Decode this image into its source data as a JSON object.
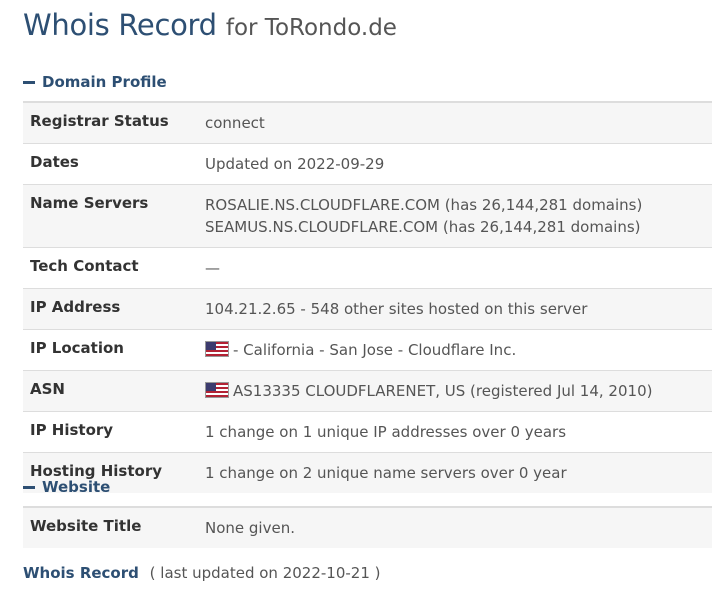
{
  "page": {
    "title_main": "Whois Record",
    "title_sub": "for ToRondo.de"
  },
  "domain_profile": {
    "heading": "Domain Profile",
    "rows": [
      {
        "label": "Registrar Status",
        "values": [
          "connect"
        ]
      },
      {
        "label": "Dates",
        "values": [
          "Updated on 2022-09-29"
        ]
      },
      {
        "label": "Name Servers",
        "values": [
          "ROSALIE.NS.CLOUDFLARE.COM (has 26,144,281 domains)",
          "SEAMUS.NS.CLOUDFLARE.COM (has 26,144,281 domains)"
        ]
      },
      {
        "label": "Tech Contact",
        "values": [
          "—"
        ]
      },
      {
        "label": "IP Address",
        "values": [
          "104.21.2.65 - 548 other sites hosted on this server"
        ]
      },
      {
        "label": "IP Location",
        "values": [
          "- California - San Jose - Cloudflare Inc."
        ],
        "flag": "us-flag-icon"
      },
      {
        "label": "ASN",
        "values": [
          "AS13335 CLOUDFLARENET, US (registered Jul 14, 2010)"
        ],
        "flag": "us-flag-icon"
      },
      {
        "label": "IP History",
        "values": [
          "1 change on 1 unique IP addresses over 0 years"
        ]
      },
      {
        "label": "Hosting History",
        "values": [
          "1 change on 2 unique name servers over 0 year"
        ]
      }
    ]
  },
  "website": {
    "heading": "Website",
    "rows": [
      {
        "label": "Website Title",
        "values": [
          "None given."
        ]
      }
    ]
  },
  "footer": {
    "link": "Whois Record",
    "updated": "( last updated on 2022-10-21 )"
  },
  "colors": {
    "accent": "#2d4f73",
    "row_shade": "#f6f6f6",
    "border": "#dddddd"
  }
}
